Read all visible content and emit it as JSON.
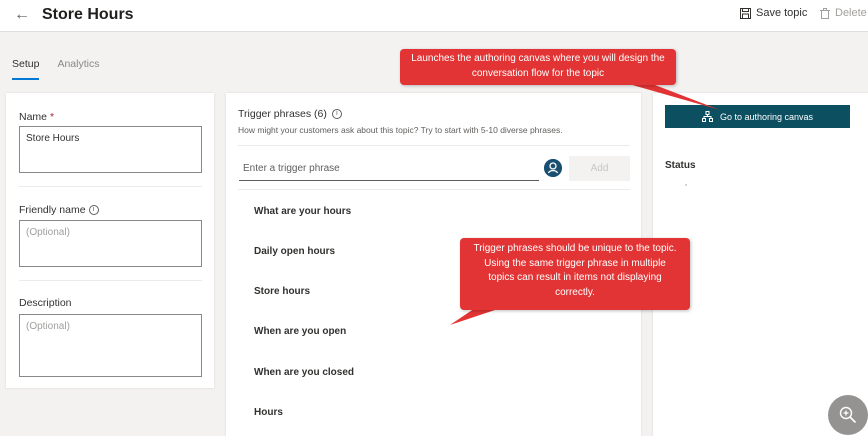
{
  "header": {
    "back_glyph": "←",
    "title": "Store Hours",
    "save_label": "Save topic",
    "delete_label": "Delete"
  },
  "tabs": [
    {
      "label": "Setup",
      "active": true
    },
    {
      "label": "Analytics",
      "active": false
    }
  ],
  "left_panel": {
    "name_label": "Name",
    "required_mark": "*",
    "name_value": "Store Hours",
    "friendly_name_label": "Friendly name",
    "friendly_name_placeholder": "(Optional)",
    "description_label": "Description",
    "description_placeholder": "(Optional)"
  },
  "trigger_phrases": {
    "title": "Trigger phrases (6)",
    "hint": "How might your customers ask about this topic? Try to start with 5-10 diverse phrases.",
    "input_placeholder": "Enter a trigger phrase",
    "add_label": "Add",
    "phrases": [
      "What are your hours",
      "Daily open hours",
      "Store hours",
      "When are you open",
      "When are you closed",
      "Hours"
    ]
  },
  "right_panel": {
    "canvas_button_label": "Go to authoring canvas",
    "status_label": "Status"
  },
  "callouts": {
    "canvas": "Launches the authoring canvas where you will design the conversation flow for the topic",
    "phrases": "Trigger phrases should be unique to the topic. Using the same trigger phrase in multiple topics can result in items not displaying correctly."
  },
  "colors": {
    "accent": "#0078d4",
    "canvas_button": "#0b4f61",
    "callout": "#e23434"
  },
  "icons": [
    "back-arrow-icon",
    "save-icon",
    "delete-icon",
    "info-icon",
    "user-avatar-icon",
    "flow-icon",
    "zoom-in-icon"
  ]
}
